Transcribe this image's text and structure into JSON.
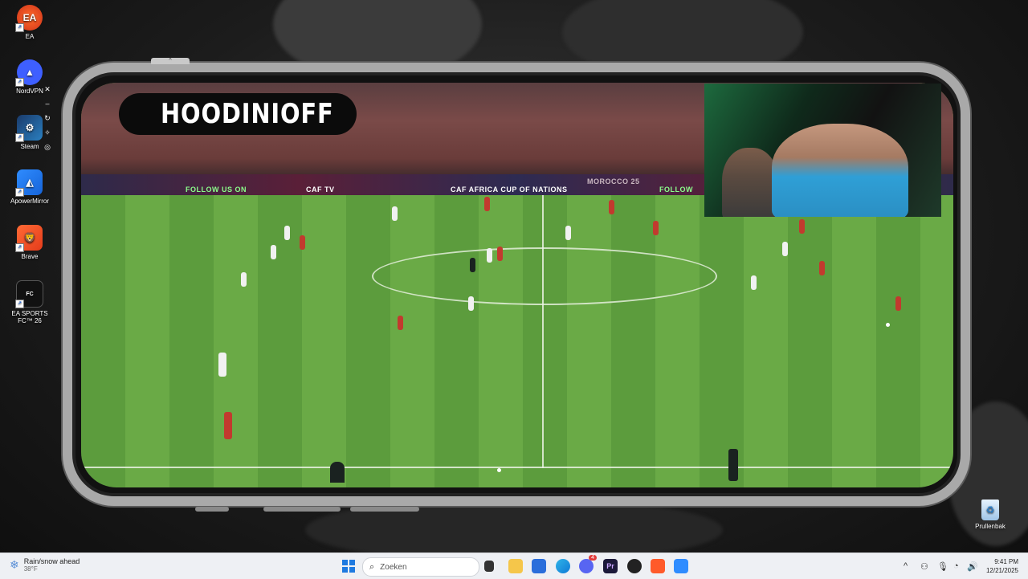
{
  "desktop": {
    "icons": [
      {
        "label": "EA",
        "icon": "ea-icon"
      },
      {
        "label": "NordVPN",
        "icon": "nordvpn-icon"
      },
      {
        "label": "Steam",
        "icon": "steam-icon"
      },
      {
        "label": "ApowerMirror",
        "icon": "apowermirror-icon"
      },
      {
        "label": "Brave",
        "icon": "brave-icon"
      },
      {
        "label": "EA SPORTS FC™ 26",
        "icon": "fc26-icon"
      }
    ],
    "recycle_bin_label": "Prullenbak"
  },
  "stream": {
    "brand_name": "HOODINIOFF",
    "ads": [
      "FOLLOW US ON",
      "CAF TV",
      "CAF AFRICA CUP OF NATIONS",
      "MOROCCO 25",
      "FOLLOW"
    ]
  },
  "taskbar": {
    "weather_title": "Rain/snow ahead",
    "weather_temp": "38°F",
    "search_placeholder": "Zoeken",
    "time": "9:41 PM",
    "date": "12/21/2025",
    "notification_badge": "4"
  }
}
